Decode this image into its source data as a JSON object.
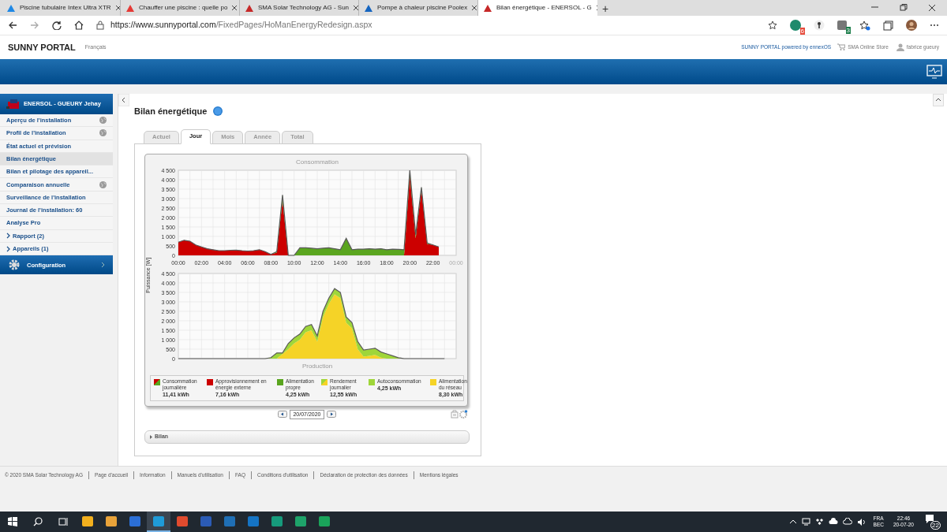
{
  "browser": {
    "tabs": [
      {
        "title": "Piscine tubulaire Intex Ultra XTR",
        "selected": false,
        "color": "#1e88e5"
      },
      {
        "title": "Chauffer une piscine : quelle po",
        "selected": false,
        "color": "#e53935"
      },
      {
        "title": "SMA Solar Technology AG - Sun",
        "selected": false,
        "color": "#c62828"
      },
      {
        "title": "Pompe à chaleur piscine Poolex",
        "selected": false,
        "color": "#1565c0"
      },
      {
        "title": "Bilan énergétique - ENERSOL - G",
        "selected": true,
        "color": "#c62828"
      }
    ],
    "new_tab": "+",
    "url_host": "https://www.sunnyportal.com",
    "url_path": "/FixedPages/HoManEnergyRedesign.aspx",
    "extension_badges": [
      "6",
      "3"
    ]
  },
  "header": {
    "logo": "SUNNY PORTAL",
    "language": "Français",
    "powered": "SUNNY PORTAL powered by ennexOS",
    "store": "SMA Online Store",
    "user": "fabrice gueury"
  },
  "sidebar": {
    "plant": "ENERSOL - GUEURY Jehay",
    "items": [
      {
        "label": "Aperçu de l'installation",
        "kind": "globe",
        "selected": false
      },
      {
        "label": "Profil de l'installation",
        "kind": "globe",
        "selected": false
      },
      {
        "label": "État actuel et prévision",
        "kind": "link",
        "selected": false
      },
      {
        "label": "Bilan énergétique",
        "kind": "link",
        "selected": true
      },
      {
        "label": "Bilan et pilotage des appareil...",
        "kind": "link",
        "selected": false
      },
      {
        "label": "Comparaison annuelle",
        "kind": "globe",
        "selected": false
      },
      {
        "label": "Surveillance de l'installation",
        "kind": "link",
        "selected": false
      },
      {
        "label": "Journal de l'installation: 60",
        "kind": "link",
        "selected": false
      },
      {
        "label": "Analyse Pro",
        "kind": "link",
        "selected": false
      },
      {
        "label": "Rapport (2)",
        "kind": "group",
        "selected": false
      },
      {
        "label": "Appareils (1)",
        "kind": "group",
        "selected": false
      }
    ],
    "config": "Configuration"
  },
  "page": {
    "title": "Bilan énergétique",
    "tabs": [
      {
        "label": "Actuel",
        "selected": false
      },
      {
        "label": "Jour",
        "selected": true
      },
      {
        "label": "Mois",
        "selected": false
      },
      {
        "label": "Année",
        "selected": false
      },
      {
        "label": "Total",
        "selected": false
      }
    ],
    "y_axis_label": "Puissance [W]",
    "charts": [
      {
        "chart_data": {
          "type": "area",
          "title": "Consommation",
          "stacked": true,
          "xlim": [
            0,
            24
          ],
          "ylim": [
            0,
            4500
          ],
          "grid": true,
          "xticks": [
            {
              "value": 0,
              "label": "00:00"
            },
            {
              "value": 2,
              "label": "02:00"
            },
            {
              "value": 4,
              "label": "04:00"
            },
            {
              "value": 6,
              "label": "06:00"
            },
            {
              "value": 8,
              "label": "08:00"
            },
            {
              "value": 10,
              "label": "10:00"
            },
            {
              "value": 12,
              "label": "12:00"
            },
            {
              "value": 14,
              "label": "14:00"
            },
            {
              "value": 16,
              "label": "16:00"
            },
            {
              "value": 18,
              "label": "18:00"
            },
            {
              "value": 20,
              "label": "20:00"
            },
            {
              "value": 22,
              "label": "22:00"
            },
            {
              "value": 24,
              "label": "00:00"
            }
          ],
          "yticks": [
            {
              "value": 0,
              "label": "0"
            },
            {
              "value": 500,
              "label": "500"
            },
            {
              "value": 1000,
              "label": "1 000"
            },
            {
              "value": 1500,
              "label": "1 500"
            },
            {
              "value": 2000,
              "label": "2 000"
            },
            {
              "value": 2500,
              "label": "2 500"
            },
            {
              "value": 3000,
              "label": "3 000"
            },
            {
              "value": 3500,
              "label": "3 500"
            },
            {
              "value": 4000,
              "label": "4 000"
            },
            {
              "value": 4500,
              "label": "4 500"
            }
          ],
          "x": [
            0,
            0.5,
            1,
            1.5,
            2,
            2.5,
            3,
            3.5,
            4,
            4.5,
            5,
            5.5,
            6,
            6.5,
            7,
            7.5,
            8,
            8.5,
            9,
            9.5,
            10,
            10.5,
            11,
            11.5,
            12,
            12.5,
            13,
            13.5,
            14,
            14.5,
            15,
            15.5,
            16,
            16.5,
            17,
            17.5,
            18,
            18.5,
            19,
            19.5,
            20,
            20.5,
            21,
            21.5,
            22,
            22.5
          ],
          "series": [
            {
              "color": "#cc0000",
              "values": [
                700,
                800,
                750,
                550,
                450,
                350,
                300,
                250,
                250,
                270,
                280,
                250,
                230,
                250,
                300,
                200,
                50,
                150,
                2900,
                0,
                0,
                0,
                0,
                0,
                0,
                0,
                0,
                0,
                0,
                0,
                0,
                0,
                0,
                0,
                0,
                0,
                0,
                0,
                0,
                0,
                4200,
                900,
                3500,
                600,
                550,
                450
              ]
            },
            {
              "color": "#5aa51f",
              "values": [
                0,
                0,
                0,
                0,
                0,
                0,
                0,
                0,
                0,
                0,
                0,
                0,
                0,
                0,
                0,
                0,
                0,
                50,
                300,
                0,
                0,
                400,
                400,
                380,
                350,
                380,
                400,
                350,
                300,
                900,
                300,
                330,
                330,
                350,
                330,
                350,
                300,
                330,
                320,
                300,
                300,
                200,
                100,
                50,
                0,
                0
              ]
            }
          ]
        }
      },
      {
        "chart_data": {
          "type": "area",
          "title": "Production",
          "stacked": true,
          "xlim": [
            0,
            24
          ],
          "ylim": [
            0,
            4500
          ],
          "grid": true,
          "yticks": [
            {
              "value": 0,
              "label": "0"
            },
            {
              "value": 500,
              "label": "500"
            },
            {
              "value": 1000,
              "label": "1 000"
            },
            {
              "value": 1500,
              "label": "1 500"
            },
            {
              "value": 2000,
              "label": "2 000"
            },
            {
              "value": 2500,
              "label": "2 500"
            },
            {
              "value": 3000,
              "label": "3 000"
            },
            {
              "value": 3500,
              "label": "3 500"
            },
            {
              "value": 4000,
              "label": "4 000"
            },
            {
              "value": 4500,
              "label": "4 500"
            }
          ],
          "x": [
            0,
            0.5,
            1,
            1.5,
            2,
            2.5,
            3,
            3.5,
            4,
            4.5,
            5,
            5.5,
            6,
            6.5,
            7,
            7.5,
            8,
            8.5,
            9,
            9.5,
            10,
            10.5,
            11,
            11.5,
            12,
            12.5,
            13,
            13.5,
            14,
            14.5,
            15,
            15.5,
            16,
            16.5,
            17,
            17.5,
            18,
            18.5,
            19,
            19.5,
            20,
            20.5,
            21,
            21.5,
            22,
            22.5,
            23
          ],
          "series": [
            {
              "color": "#f5d327",
              "values": [
                0,
                0,
                0,
                0,
                0,
                0,
                0,
                0,
                0,
                0,
                0,
                0,
                0,
                0,
                0,
                0,
                0,
                0,
                250,
                500,
                800,
                1000,
                1400,
                1500,
                900,
                2200,
                2900,
                3400,
                3200,
                1900,
                1600,
                500,
                100,
                150,
                200,
                50,
                0,
                0,
                0,
                0,
                0,
                0,
                0,
                0,
                0,
                0,
                0
              ]
            },
            {
              "color": "#9fd63a",
              "values": [
                0,
                0,
                0,
                0,
                0,
                0,
                0,
                0,
                0,
                0,
                0,
                0,
                0,
                0,
                0,
                0,
                50,
                300,
                50,
                300,
                300,
                300,
                300,
                300,
                300,
                300,
                300,
                300,
                300,
                300,
                300,
                400,
                350,
                350,
                350,
                300,
                250,
                150,
                50,
                0,
                0,
                0,
                0,
                0,
                0,
                0,
                0
              ]
            }
          ]
        }
      }
    ],
    "legend": [
      {
        "label": "Consommation journalière",
        "value": "11,41 kWh",
        "kind": "total"
      },
      {
        "label": "Approvisionnement en énergie externe",
        "value": "7,16 kWh",
        "color": "#cc0000"
      },
      {
        "label": "Alimentation propre",
        "value": "4,25 kWh",
        "color": "#5aa51f"
      },
      {
        "label": "Rendement journalier",
        "value": "12,55 kWh",
        "kind": "total"
      },
      {
        "label": "Autoconsommation",
        "value": "4,25 kWh",
        "color": "#9fd63a"
      },
      {
        "label": "Alimentation du réseau",
        "value": "8,30 kWh",
        "color": "#f5d327"
      }
    ],
    "date": "20/07/2020",
    "bilan": "Bilan"
  },
  "footer": [
    "© 2020 SMA Solar Technology AG",
    "Page d'accueil",
    "Information",
    "Manuels d'utilisation",
    "FAQ",
    "Conditions d'utilisation",
    "Déclaration de protection des données",
    "Mentions légales"
  ],
  "taskbar": {
    "apps": [
      {
        "color": "#f2b01e",
        "selected": false
      },
      {
        "color": "#e8a33a",
        "selected": false
      },
      {
        "color": "#2b6fd6",
        "selected": false
      },
      {
        "color": "#1f9bd7",
        "selected": true
      },
      {
        "color": "#e04b2e",
        "selected": false
      },
      {
        "color": "#2b5bb5",
        "selected": false
      },
      {
        "color": "#1f6fb5",
        "selected": false
      },
      {
        "color": "#1574c4",
        "selected": false
      },
      {
        "color": "#169b7c",
        "selected": false
      },
      {
        "color": "#1ea36a",
        "selected": false
      },
      {
        "color": "#1aa35a",
        "selected": false
      }
    ],
    "lang": "FRA",
    "layout": "BEC",
    "time": "22:46",
    "date": "20-07-20",
    "notifications": "22"
  }
}
